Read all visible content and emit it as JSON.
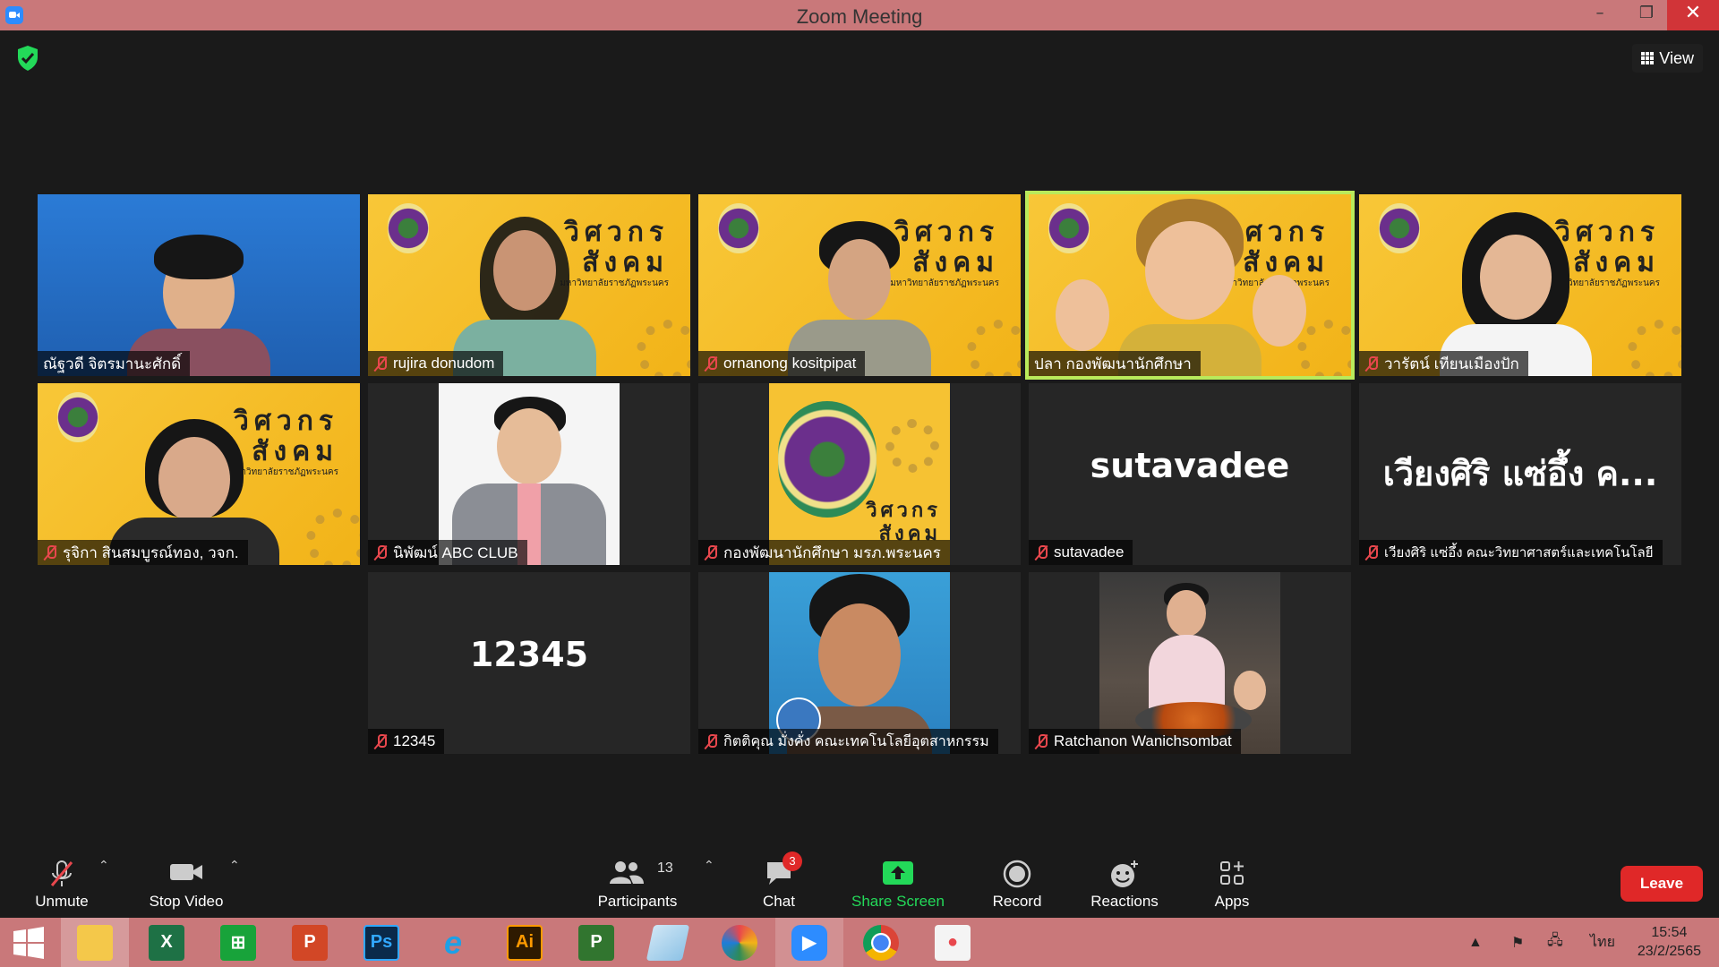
{
  "window": {
    "title": "Zoom Meeting"
  },
  "topbar": {
    "view_label": "View"
  },
  "tiles": [
    {
      "name": "ณัฐวดี จิตรมานะศักดิ์",
      "muted": false,
      "speaking": false
    },
    {
      "name": "rujira donudom",
      "muted": true,
      "speaking": false
    },
    {
      "name": "ornanong kositpipat",
      "muted": true,
      "speaking": false
    },
    {
      "name": "ปลา กองพัฒนานักศึกษา",
      "muted": false,
      "speaking": true
    },
    {
      "name": "วารัตน์ เทียนเมืองปัก",
      "muted": true,
      "speaking": false
    },
    {
      "name": "รุจิกา สินสมบูรณ์ทอง, วจก.",
      "muted": true,
      "speaking": false
    },
    {
      "name": "นิพัฒน์ ABC CLUB",
      "muted": true,
      "speaking": false
    },
    {
      "name": "กองพัฒนานักศึกษา มรภ.พระนคร",
      "muted": true,
      "speaking": false
    },
    {
      "name": "sutavadee",
      "muted": true,
      "speaking": false,
      "display_text": "sutavadee"
    },
    {
      "name": "เวียงศิริ แซ่อึ้ง คณะวิทยาศาสตร์และเทคโนโลยี",
      "muted": true,
      "speaking": false,
      "display_text": "เวียงศิริ แซ่อึ้ง ค..."
    },
    {
      "name": "12345",
      "muted": true,
      "speaking": false,
      "display_text": "12345"
    },
    {
      "name": "กิตติคุณ มั่งคั่ง คณะเทคโนโลยีอุตสาหกรรม",
      "muted": true,
      "speaking": false
    },
    {
      "name": "Ratchanon Wanichsombat",
      "muted": true,
      "speaking": false
    }
  ],
  "banner": {
    "brand_line1": "วิศวกร",
    "brand_line2": "สังคม",
    "brand_sub": "มหาวิทยาลัยราชภัฏพระนคร"
  },
  "toolbar": {
    "unmute_label": "Unmute",
    "stop_video_label": "Stop Video",
    "participants_label": "Participants",
    "participants_count": "13",
    "chat_label": "Chat",
    "chat_badge": "3",
    "share_label": "Share Screen",
    "record_label": "Record",
    "reactions_label": "Reactions",
    "apps_label": "Apps",
    "leave_label": "Leave"
  },
  "taskbar": {
    "apps": [
      "file-explorer",
      "excel",
      "store",
      "powerpoint",
      "photoshop",
      "internet-explorer",
      "illustrator",
      "project",
      "notepad",
      "photoscape",
      "zoom",
      "chrome",
      "paint"
    ],
    "illustrator_label": "Ai",
    "photoshop_label": "Ps",
    "language": "ไทย",
    "time": "15:54",
    "date": "23/2/2565"
  },
  "colors": {
    "speaking_border": "#b9ea5b",
    "leave": "#e02828",
    "share": "#23d959",
    "titlebar": "#c9787a"
  }
}
